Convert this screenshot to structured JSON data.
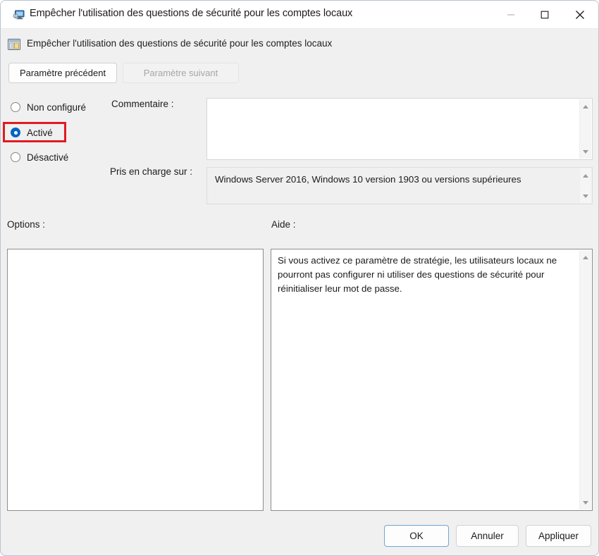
{
  "window": {
    "title": "Empêcher l'utilisation des questions de sécurité pour les comptes locaux",
    "icon": "policy-computer-icon",
    "controls": {
      "minimize": "minimize-icon",
      "maximize": "maximize-icon",
      "close": "close-icon"
    }
  },
  "header": {
    "icon": "group-policy-setting-icon",
    "title": "Empêcher l'utilisation des questions de sécurité pour les comptes locaux"
  },
  "navigation": {
    "previous_label": "Paramètre précédent",
    "next_label": "Paramètre suivant",
    "next_disabled": true
  },
  "state": {
    "options": [
      {
        "label": "Non configuré",
        "selected": false
      },
      {
        "label": "Activé",
        "selected": true
      },
      {
        "label": "Désactivé",
        "selected": false
      }
    ],
    "highlight_color": "#e01b22",
    "selected_color": "#0067c0"
  },
  "comment": {
    "label": "Commentaire :",
    "value": "",
    "placeholder": ""
  },
  "supported": {
    "label": "Pris en charge sur :",
    "value": "Windows Server 2016, Windows 10 version 1903 ou versions supérieures"
  },
  "options_section": {
    "label": "Options :",
    "content": ""
  },
  "help_section": {
    "label": "Aide :",
    "content": "Si vous activez ce paramètre de stratégie, les utilisateurs locaux ne pourront pas configurer ni utiliser des questions de sécurité pour réinitialiser leur mot de passe."
  },
  "footer": {
    "ok_label": "OK",
    "cancel_label": "Annuler",
    "apply_label": "Appliquer"
  },
  "icons": {
    "scroll_up": "scroll-up-arrow-icon",
    "scroll_down": "scroll-down-arrow-icon"
  }
}
